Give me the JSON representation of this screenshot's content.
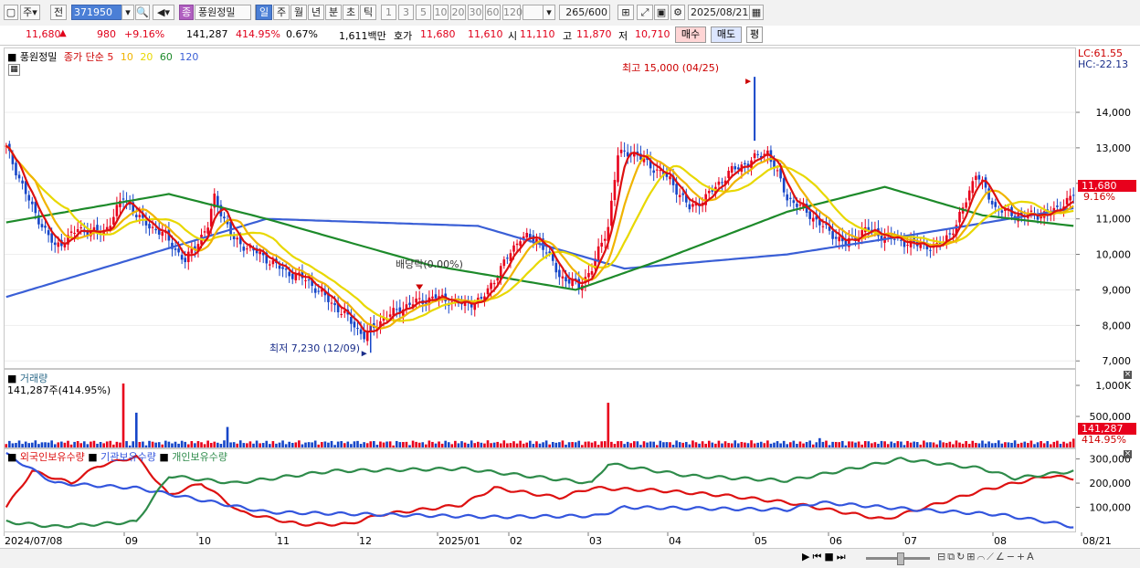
{
  "toolbar": {
    "mode": "주",
    "prev": "전",
    "code": "371950",
    "name_badge": "종",
    "name": "풍원정밀",
    "periods": [
      "일",
      "주",
      "월",
      "년",
      "분",
      "초",
      "틱"
    ],
    "active_period": "일",
    "intervals": [
      "1",
      "3",
      "5",
      "10",
      "20",
      "30",
      "60",
      "120"
    ],
    "count": "265",
    "count_total": "/600",
    "date": "2025/08/21"
  },
  "quote": {
    "price": "11,680",
    "change": "980",
    "change_pct": "+9.16%",
    "volume": "141,287",
    "volume_pct": "414.95%",
    "turnover": "0.67%",
    "amount": "1,611백만",
    "ask_label": "호가",
    "ask1": "11,680",
    "ask2": "11,610",
    "open_label": "시",
    "open": "11,110",
    "high_label": "고",
    "high": "11,870",
    "low_label": "저",
    "low": "10,710",
    "buy": "매수",
    "sell": "매도",
    "eval": "평"
  },
  "price_panel": {
    "title": "풍원정밀",
    "legend_prefix": "종가 단순",
    "ma": [
      {
        "period": "5",
        "color": "#dd1111"
      },
      {
        "period": "10",
        "color": "#f0b400"
      },
      {
        "period": "20",
        "color": "#e8d800"
      },
      {
        "period": "60",
        "color": "#1d8a2a"
      },
      {
        "period": "120",
        "color": "#3a5fd6"
      }
    ],
    "lc": "LC:61.55",
    "hc": "HC:-22.13",
    "high_annot": "최고 15,000 (04/25)",
    "low_annot": "최저 7,230 (12/09)",
    "div_annot": "배당락(0.00%)",
    "last_price": "11,680",
    "last_pct": "9.16%"
  },
  "volume_panel": {
    "title": "거래량",
    "readout": "141,287주(414.95%)",
    "last_volume": "141,287",
    "last_pct": "414.95%"
  },
  "holdings_panel": {
    "series": [
      {
        "name": "외국인보유수량",
        "color": "#dd1111"
      },
      {
        "name": "기관보유수량",
        "color": "#3355dd"
      },
      {
        "name": "개인보유수량",
        "color": "#2e8b4a"
      }
    ]
  },
  "x_labels": [
    "2024/07/08",
    "09",
    "10",
    "11",
    "12",
    "2025/01",
    "02",
    "03",
    "04",
    "05",
    "06",
    "07",
    "08",
    "08/21"
  ],
  "chart_data": [
    {
      "type": "candlestick",
      "title": "풍원정밀",
      "ylim": [
        6800,
        15800
      ],
      "yticks": [
        7000,
        8000,
        9000,
        10000,
        11000,
        12000,
        13000,
        14000
      ],
      "ytick_labels": [
        "7,000",
        "8,000",
        "9,000",
        "10,000",
        "11,000",
        "12,000",
        "13,000",
        "14,000"
      ],
      "close_anchors": [
        [
          0,
          13000
        ],
        [
          8,
          11300
        ],
        [
          15,
          10200
        ],
        [
          22,
          10700
        ],
        [
          30,
          10600
        ],
        [
          36,
          11600
        ],
        [
          42,
          10900
        ],
        [
          48,
          10600
        ],
        [
          55,
          9800
        ],
        [
          62,
          10800
        ],
        [
          64,
          11600
        ],
        [
          70,
          10400
        ],
        [
          78,
          10000
        ],
        [
          86,
          9500
        ],
        [
          92,
          9300
        ],
        [
          98,
          8800
        ],
        [
          104,
          8300
        ],
        [
          110,
          7700
        ],
        [
          116,
          8200
        ],
        [
          124,
          8600
        ],
        [
          132,
          8800
        ],
        [
          140,
          8600
        ],
        [
          146,
          8700
        ],
        [
          152,
          9600
        ],
        [
          158,
          10500
        ],
        [
          164,
          10400
        ],
        [
          170,
          9400
        ],
        [
          176,
          9100
        ],
        [
          180,
          9600
        ],
        [
          185,
          10800
        ],
        [
          188,
          12800
        ],
        [
          192,
          12900
        ],
        [
          198,
          12500
        ],
        [
          204,
          12100
        ],
        [
          210,
          11300
        ],
        [
          215,
          11600
        ],
        [
          222,
          12300
        ],
        [
          228,
          12600
        ],
        [
          234,
          12900
        ],
        [
          240,
          11600
        ],
        [
          246,
          11200
        ],
        [
          252,
          10700
        ],
        [
          258,
          10300
        ],
        [
          264,
          10700
        ],
        [
          270,
          10500
        ],
        [
          278,
          10300
        ],
        [
          286,
          10200
        ],
        [
          292,
          10800
        ],
        [
          298,
          12300
        ],
        [
          304,
          11300
        ],
        [
          310,
          11100
        ],
        [
          316,
          11100
        ],
        [
          322,
          11200
        ],
        [
          328,
          11680
        ]
      ],
      "ma_levels": {
        "5": "computed",
        "10": "computed",
        "20": "computed",
        "60": [
          [
            0,
            10900
          ],
          [
            50,
            11700
          ],
          [
            80,
            11000
          ],
          [
            130,
            9700
          ],
          [
            175,
            9000
          ],
          [
            200,
            9800
          ],
          [
            240,
            11200
          ],
          [
            270,
            11900
          ],
          [
            300,
            11100
          ],
          [
            328,
            10800
          ]
        ],
        "120": [
          [
            0,
            8800
          ],
          [
            80,
            11000
          ],
          [
            145,
            10800
          ],
          [
            190,
            9600
          ],
          [
            240,
            10000
          ],
          [
            275,
            10500
          ],
          [
            328,
            11300
          ]
        ]
      },
      "annotations": [
        {
          "text": "최고 15,000 (04/25)",
          "x": 230,
          "y": 15000
        },
        {
          "text": "최저 7,230 (12/09)",
          "x": 112,
          "y": 7230
        },
        {
          "text": "배당락(0.00%)",
          "x": 127,
          "y": 9000
        }
      ]
    },
    {
      "type": "bar",
      "title": "거래량",
      "ylim": [
        0,
        1250000
      ],
      "yticks": [
        500000,
        1000000
      ],
      "ytick_labels": [
        "500,000",
        "1,000K"
      ],
      "spikes": [
        [
          36,
          1030000
        ],
        [
          40,
          560000
        ],
        [
          68,
          330000
        ],
        [
          185,
          720000
        ],
        [
          250,
          150000
        ],
        [
          328,
          141287
        ]
      ]
    },
    {
      "type": "line",
      "series_names": [
        "외국인보유수량",
        "기관보유수량",
        "개인보유수량"
      ],
      "ylim": [
        0,
        340000
      ],
      "yticks": [
        100000,
        200000,
        300000
      ],
      "ytick_labels": [
        "100,000",
        "200,000",
        "300,000"
      ],
      "series": [
        {
          "name": "외국인보유수량",
          "anchors": [
            [
              0,
              100000
            ],
            [
              8,
              250000
            ],
            [
              20,
              200000
            ],
            [
              28,
              270000
            ],
            [
              40,
              310000
            ],
            [
              50,
              150000
            ],
            [
              60,
              200000
            ],
            [
              72,
              80000
            ],
            [
              90,
              30000
            ],
            [
              105,
              30000
            ],
            [
              115,
              70000
            ],
            [
              140,
              110000
            ],
            [
              150,
              180000
            ],
            [
              170,
              140000
            ],
            [
              180,
              180000
            ],
            [
              200,
              170000
            ],
            [
              220,
              150000
            ],
            [
              240,
              120000
            ],
            [
              270,
              50000
            ],
            [
              300,
              170000
            ],
            [
              320,
              230000
            ],
            [
              328,
              220000
            ]
          ]
        },
        {
          "name": "기관보유수량",
          "anchors": [
            [
              0,
              320000
            ],
            [
              15,
              200000
            ],
            [
              40,
              180000
            ],
            [
              80,
              80000
            ],
            [
              150,
              60000
            ],
            [
              182,
              65000
            ],
            [
              190,
              100000
            ],
            [
              240,
              90000
            ],
            [
              250,
              120000
            ],
            [
              280,
              90000
            ],
            [
              305,
              70000
            ],
            [
              320,
              40000
            ],
            [
              328,
              20000
            ]
          ]
        },
        {
          "name": "개인보유수량",
          "anchors": [
            [
              0,
              40000
            ],
            [
              15,
              20000
            ],
            [
              40,
              40000
            ],
            [
              50,
              230000
            ],
            [
              70,
              200000
            ],
            [
              100,
              250000
            ],
            [
              140,
              260000
            ],
            [
              180,
              200000
            ],
            [
              185,
              280000
            ],
            [
              210,
              230000
            ],
            [
              240,
              210000
            ],
            [
              260,
              260000
            ],
            [
              275,
              300000
            ],
            [
              300,
              260000
            ],
            [
              310,
              220000
            ],
            [
              328,
              250000
            ]
          ]
        }
      ]
    }
  ]
}
